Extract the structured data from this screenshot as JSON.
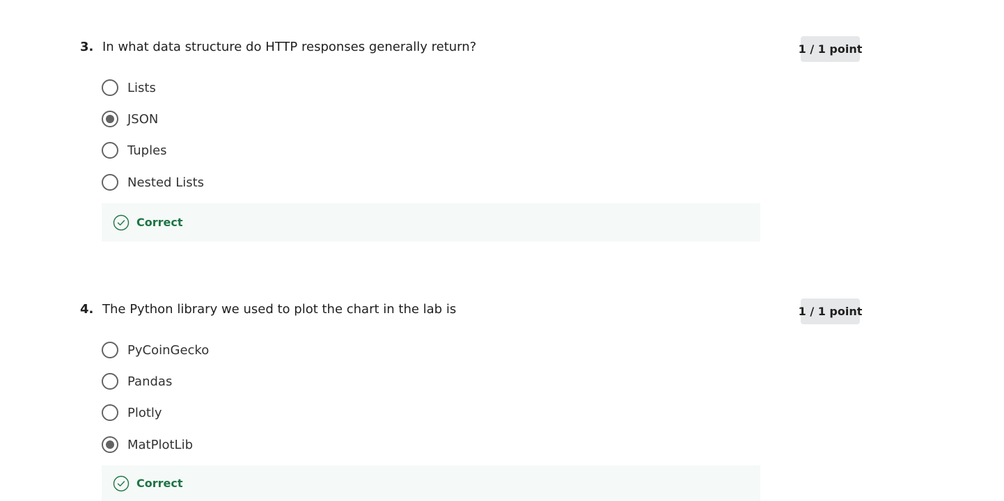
{
  "colors": {
    "correct": "#1d7446",
    "feedback_bg": "#f5f9f7",
    "badge_bg": "#e5e7e8",
    "radio": "#636363"
  },
  "questions": [
    {
      "number": "3.",
      "text": "In what data structure do HTTP responses generally return?",
      "points": "1 / 1 point",
      "options": [
        {
          "label": "Lists",
          "selected": false
        },
        {
          "label": "JSON",
          "selected": true
        },
        {
          "label": "Tuples",
          "selected": false
        },
        {
          "label": "Nested Lists",
          "selected": false
        }
      ],
      "feedback": {
        "icon": "check-circle-icon",
        "label": "Correct"
      }
    },
    {
      "number": "4.",
      "text": "The Python library we used to plot the chart in the lab is",
      "points": "1 / 1 point",
      "options": [
        {
          "label": "PyCoinGecko",
          "selected": false
        },
        {
          "label": "Pandas",
          "selected": false
        },
        {
          "label": "Plotly",
          "selected": false
        },
        {
          "label": "MatPlotLib",
          "selected": true
        }
      ],
      "feedback": {
        "icon": "check-circle-icon",
        "label": "Correct"
      }
    }
  ]
}
